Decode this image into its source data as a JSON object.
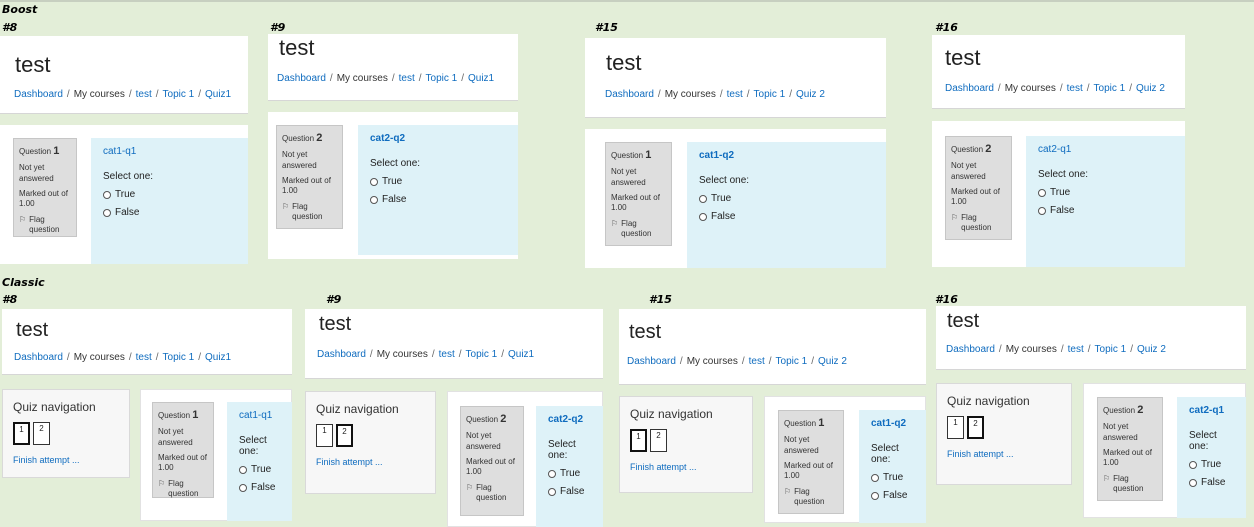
{
  "labels": {
    "boost": "Boost",
    "classic": "Classic",
    "p8": "#8",
    "p9": "#9",
    "p15": "#15",
    "p16": "#16"
  },
  "site": {
    "title": "test"
  },
  "breadcrumb": {
    "dashboard": "Dashboard",
    "mycourses": "My courses",
    "course": "test",
    "topic": "Topic 1",
    "quiz1": "Quiz1",
    "quiz2": "Quiz 2",
    "sep": "/"
  },
  "question": {
    "label": "Question",
    "n1": "1",
    "n2": "2",
    "status": "Not yet answered",
    "marked": "Marked out of 1.00",
    "flag": "Flag question",
    "flag_icon": "flag-icon",
    "prompt": "Select one:",
    "opt_true": "True",
    "opt_false": "False",
    "name_c1q1": "cat1-q1",
    "name_c2q2": "cat2-q2",
    "name_c1q2": "cat1-q2",
    "name_c2q1": "cat2-q1"
  },
  "nav": {
    "title": "Quiz navigation",
    "b1": "1",
    "b2": "2",
    "finish": "Finish attempt ..."
  },
  "colors": {
    "background": "#e3eed8",
    "link": "#0f6cbf",
    "question_info": "#dedede",
    "question_content": "#def2f8"
  }
}
